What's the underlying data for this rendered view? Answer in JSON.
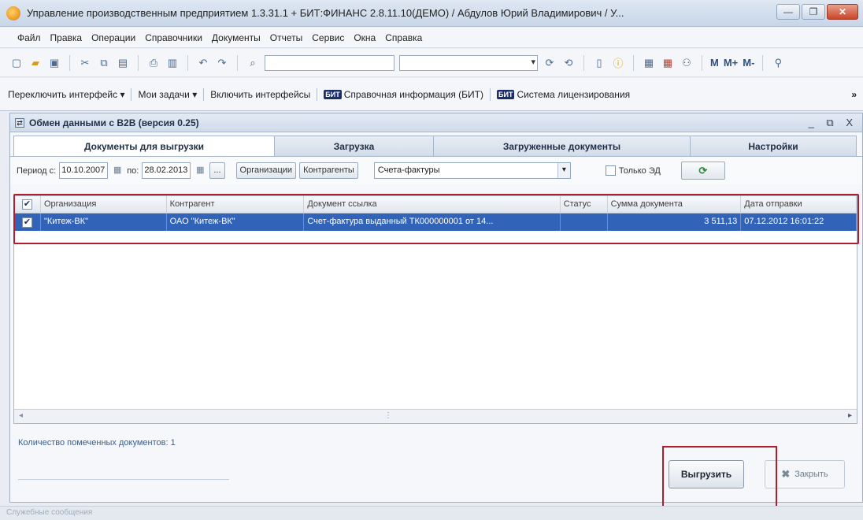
{
  "app": {
    "title": "Управление производственным предприятием 1.3.31.1 + БИТ:ФИНАНС 2.8.11.10(ДЕМО) / Абдулов Юрий Владимирович / У...",
    "win_controls": {
      "minimize": "—",
      "maximize": "❐",
      "close": "✕"
    }
  },
  "menu": [
    "Файл",
    "Правка",
    "Операции",
    "Справочники",
    "Документы",
    "Отчеты",
    "Сервис",
    "Окна",
    "Справка"
  ],
  "toolbar": {
    "mem_m": "M",
    "mem_mplus": "M+",
    "mem_mminus": "M-"
  },
  "favbar": {
    "switch_interface": "Переключить интерфейс",
    "my_tasks": "Мои задачи",
    "enable_interfaces": "Включить интерфейсы",
    "bit_badge": "БИТ",
    "help_info": "Справочная информация (БИТ)",
    "licensing": "Система лицензирования",
    "more": "»"
  },
  "window": {
    "title": "Обмен данными с B2B (версия 0.25)",
    "controls": "_ ⧉ X"
  },
  "tabs": [
    {
      "label": "Документы для выгрузки"
    },
    {
      "label": "Загрузка"
    },
    {
      "label": "Загруженные документы"
    },
    {
      "label": "Настройки"
    }
  ],
  "filters": {
    "period_label": "Период с:",
    "date_from": "10.10.2007",
    "to_label": "по:",
    "date_to": "28.02.2013",
    "ellipsis": "...",
    "org_button": "Организации",
    "kontr_button": "Контрагенты",
    "doc_type": "Счета-фактуры",
    "only_ed_label": "Только ЭД"
  },
  "grid": {
    "columns": [
      "Организация",
      "Контрагент",
      "Документ ссылка",
      "Статус",
      "Сумма документа",
      "Дата отправки"
    ],
    "rows": [
      {
        "checked": true,
        "org": "\"Китеж-ВК\"",
        "kontr": "ОАО \"Китеж-ВК\"",
        "doc": "Счет-фактура выданный ТК000000001 от 14...",
        "status": "",
        "sum": "3 511,13",
        "date": "07.12.2012 16:01:22"
      }
    ]
  },
  "footer": {
    "count_label": "Количество помеченных документов: 1",
    "export_button": "Выгрузить",
    "close_button": "Закрыть"
  },
  "statusbar": "Служебные сообщения",
  "colors": {
    "selected_row": "#3163b8",
    "highlight": "#b21d2b"
  }
}
